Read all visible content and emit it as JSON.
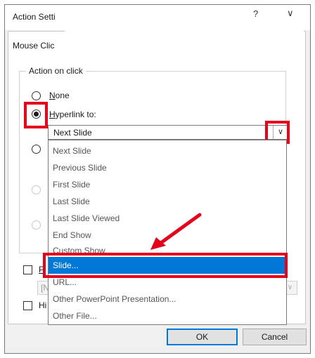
{
  "dialog": {
    "title": "Action Setti",
    "help": "?",
    "close": "∨"
  },
  "tab": {
    "label": "Mouse Clic"
  },
  "action_group": {
    "legend": "Action on click",
    "options": [
      {
        "key": "N",
        "rest": "one",
        "checked": false
      },
      {
        "key": "H",
        "rest": "yperlink to:",
        "checked": true
      }
    ]
  },
  "hyperlink_combo": {
    "value": "Next Slide",
    "arrow": "∨"
  },
  "dropdown": {
    "items": [
      "Next Slide",
      "Previous Slide",
      "First Slide",
      "Last Slide",
      "Last Slide Viewed",
      "End Show",
      "Custom Show..."
    ],
    "selected": "Slide...",
    "after": [
      "URL...",
      "Other PowerPoint Presentation...",
      "Other File..."
    ]
  },
  "play_sound": {
    "label": "P",
    "value": "[N"
  },
  "highlight": {
    "label": "Hi"
  },
  "buttons": {
    "ok": "OK",
    "cancel": "Cancel"
  },
  "colors": {
    "highlight": "#e5001c",
    "selection": "#0078d7"
  }
}
